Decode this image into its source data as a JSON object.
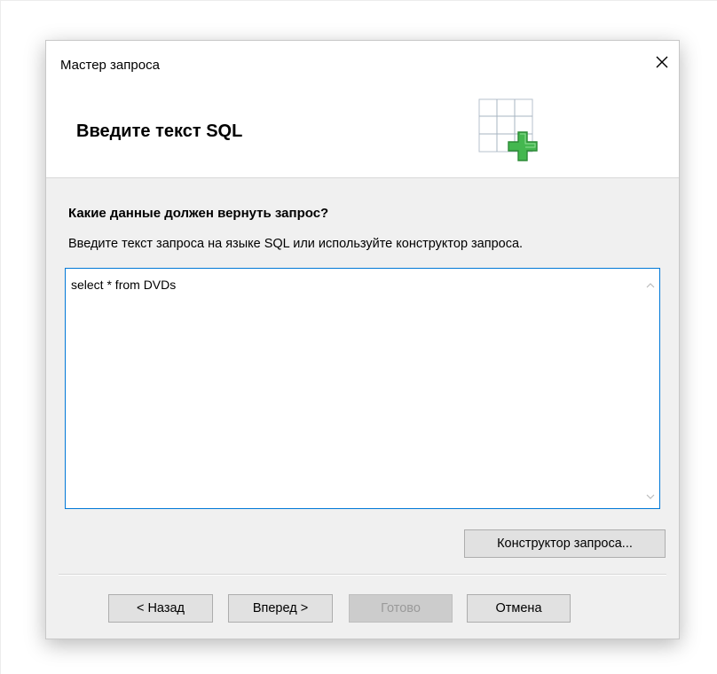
{
  "dialog": {
    "window_title": "Мастер запроса",
    "heading": "Введите текст SQL",
    "icon": "table-add-icon"
  },
  "main": {
    "question": "Какие данные должен вернуть запрос?",
    "instruction": "Введите текст запроса на языке SQL или используйте конструктор запроса.",
    "sql_value": "select * from DVDs",
    "builder_button": "Конструктор запроса..."
  },
  "footer": {
    "back": "< Назад",
    "next": "Вперед >",
    "finish": "Готово",
    "cancel": "Отмена"
  },
  "colors": {
    "accent": "#0078d7",
    "icon_plus": "#3cb44a",
    "dialog_bg": "#f0f0f0"
  }
}
